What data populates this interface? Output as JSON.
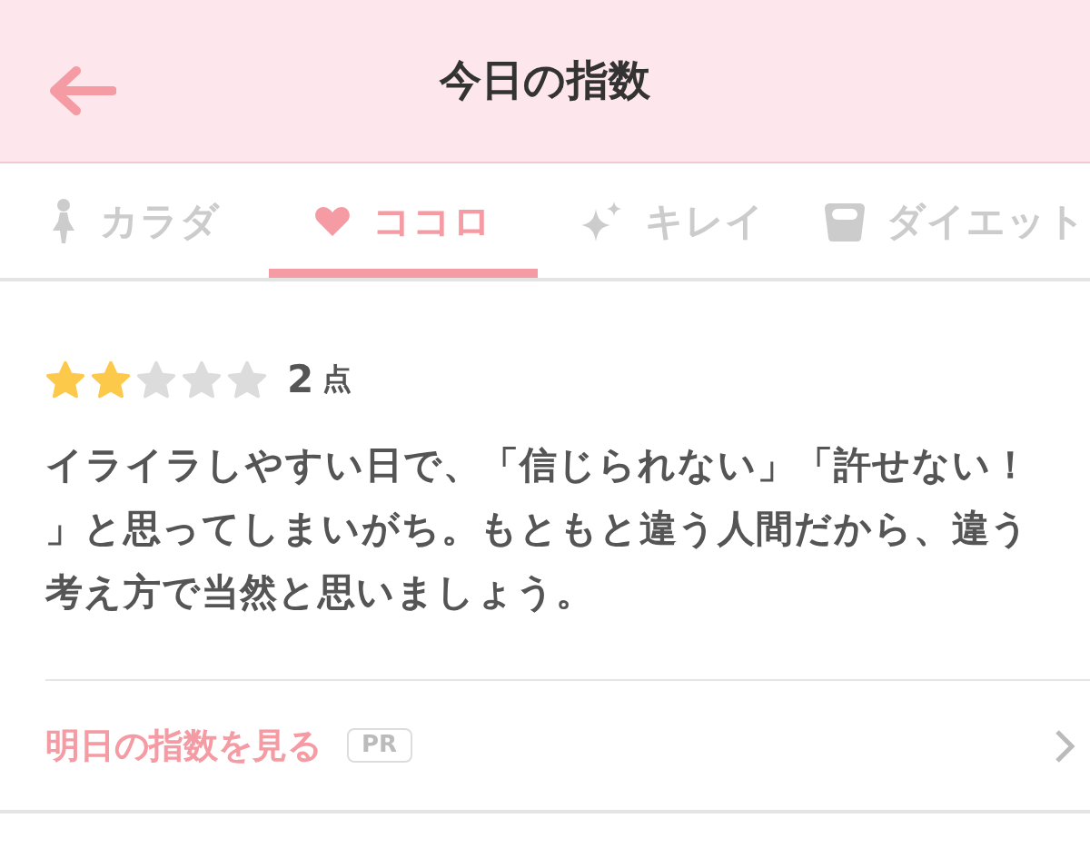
{
  "header": {
    "title": "今日の指数"
  },
  "tabs": [
    {
      "label": "カラダ",
      "selected": false
    },
    {
      "label": "ココロ",
      "selected": true
    },
    {
      "label": "キレイ",
      "selected": false
    },
    {
      "label": "ダイエット",
      "selected": false
    }
  ],
  "rating": {
    "stars": 2,
    "score": "2",
    "unit": "点"
  },
  "message": "イライラしやすい日で、「信じられない」「許せない！」と思ってしまいがち。もともと違う人間だから、違う考え方で当然と思いましょう。",
  "link": {
    "label": "明日の指数を見る",
    "badge": "PR"
  }
}
